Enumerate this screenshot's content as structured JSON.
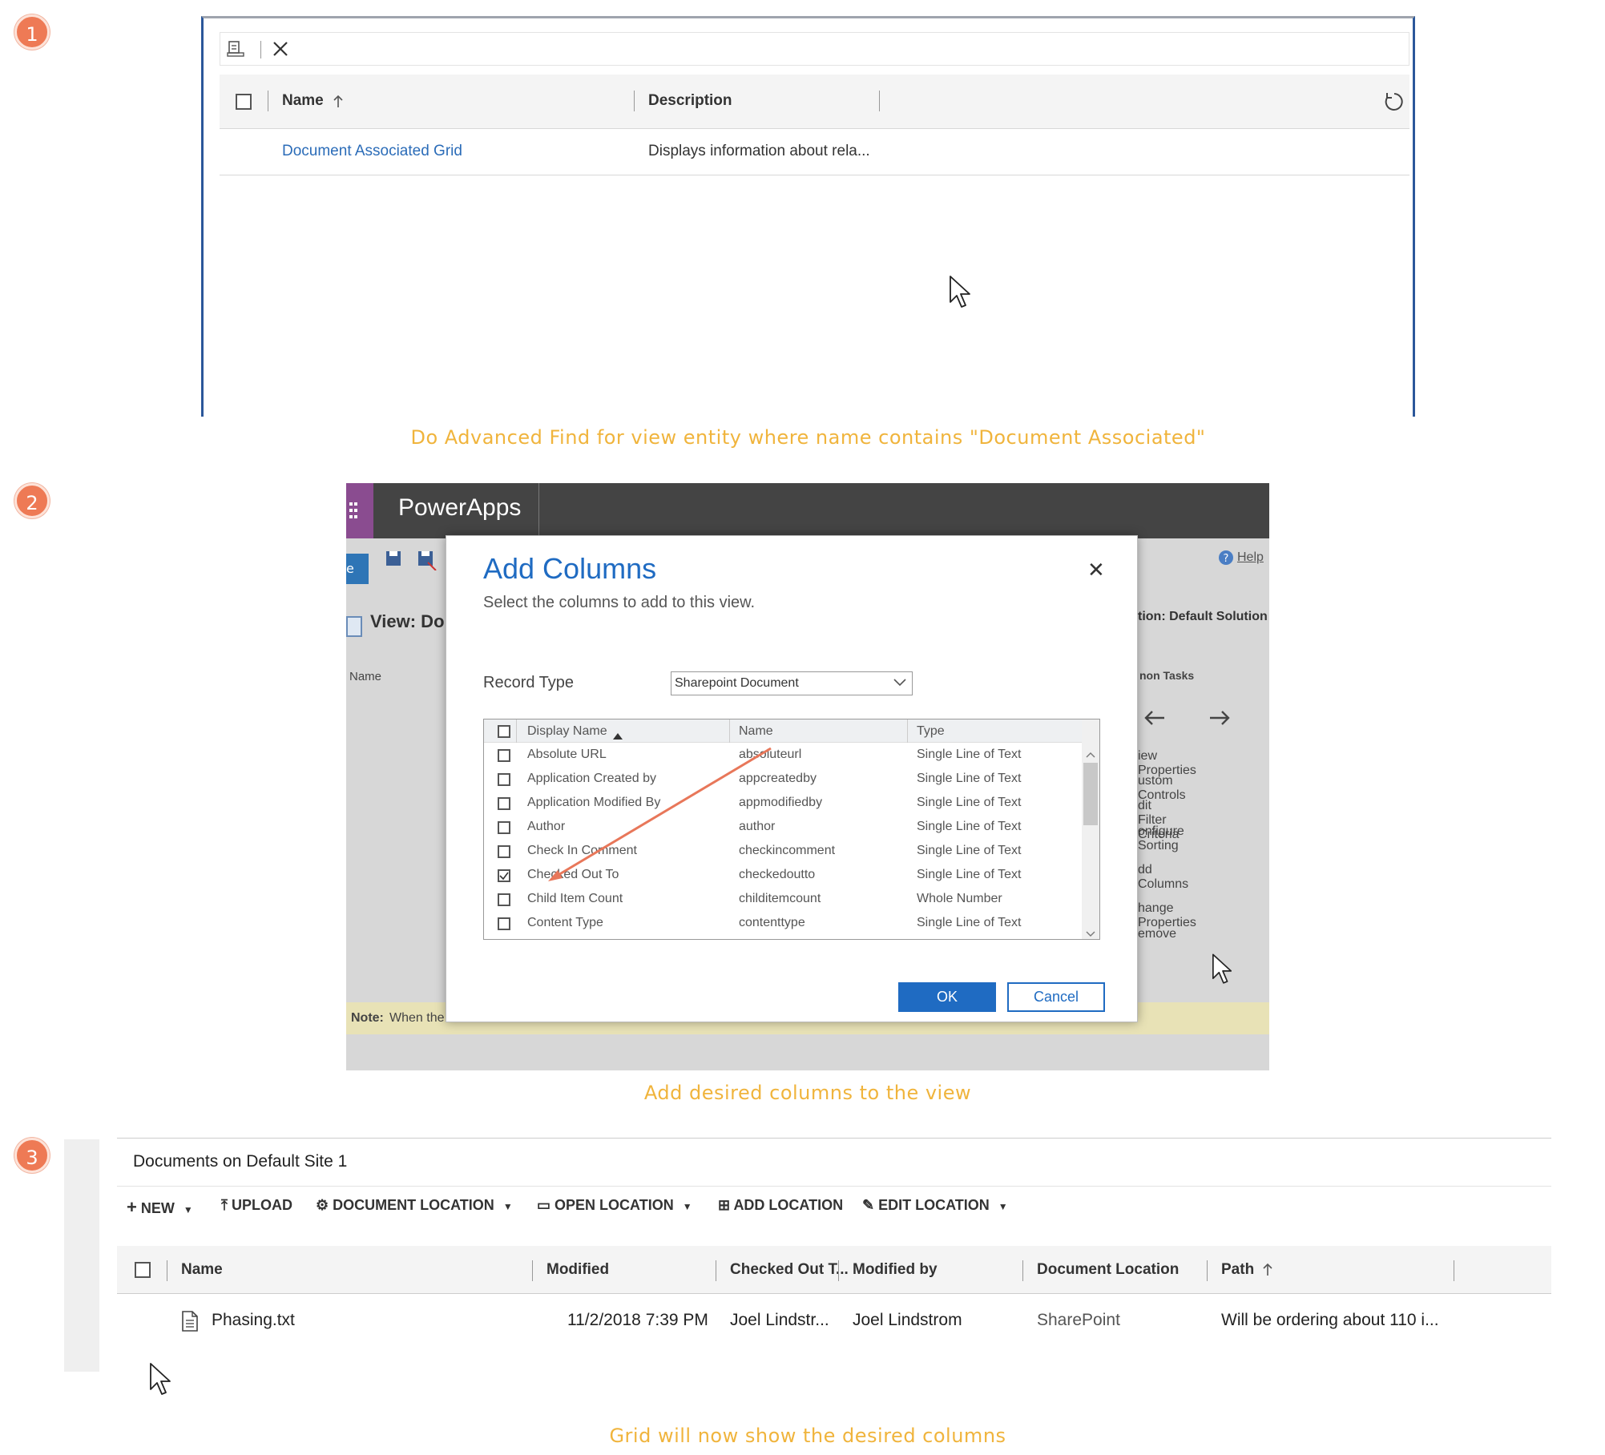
{
  "steps": [
    "1",
    "2",
    "3"
  ],
  "captions": {
    "step1": "Do Advanced Find for view entity where name contains \"Document Associated\"",
    "step2": "Add desired columns to the view",
    "step3": "Grid will now show the desired columns"
  },
  "panel1": {
    "columns": {
      "name": "Name",
      "description": "Description"
    },
    "row": {
      "name": "Document Associated Grid",
      "description": "Displays information about rela..."
    }
  },
  "panel2": {
    "brand": "PowerApps",
    "help": "Help",
    "view_title": "View: Do",
    "bg_name_col": "Name",
    "solution": "tion: Default Solution",
    "common_tasks": "non Tasks",
    "tasks": [
      "iew Properties",
      "ustom Controls",
      "dit Filter Criteria",
      "onfigure Sorting",
      "dd Columns",
      "hange Properties",
      "emove"
    ],
    "note_label": "Note:",
    "note_text": "When the",
    "dialog": {
      "title": "Add Columns",
      "subtitle": "Select the columns to add to this view.",
      "record_type_label": "Record Type",
      "record_type_value": "Sharepoint Document",
      "columns": {
        "display": "Display Name",
        "name": "Name",
        "type": "Type"
      },
      "rows": [
        {
          "display": "Absolute URL",
          "name": "absoluteurl",
          "type": "Single Line of Text",
          "checked": false
        },
        {
          "display": "Application Created by",
          "name": "appcreatedby",
          "type": "Single Line of Text",
          "checked": false
        },
        {
          "display": "Application Modified By",
          "name": "appmodifiedby",
          "type": "Single Line of Text",
          "checked": false
        },
        {
          "display": "Author",
          "name": "author",
          "type": "Single Line of Text",
          "checked": false
        },
        {
          "display": "Check In Comment",
          "name": "checkincomment",
          "type": "Single Line of Text",
          "checked": false
        },
        {
          "display": "Checked Out To",
          "name": "checkedoutto",
          "type": "Single Line of Text",
          "checked": true
        },
        {
          "display": "Child Item Count",
          "name": "childitemcount",
          "type": "Whole Number",
          "checked": false
        },
        {
          "display": "Content Type",
          "name": "contenttype",
          "type": "Single Line of Text",
          "checked": false
        }
      ],
      "ok": "OK",
      "cancel": "Cancel"
    }
  },
  "panel3": {
    "title": "Documents on Default Site 1",
    "commands": {
      "new": "NEW",
      "upload": "UPLOAD",
      "doc_location": "DOCUMENT LOCATION",
      "open_location": "OPEN LOCATION",
      "add_location": "ADD LOCATION",
      "edit_location": "EDIT LOCATION"
    },
    "columns": {
      "name": "Name",
      "modified": "Modified",
      "checked_out": "Checked Out T...",
      "modified_by": "Modified by",
      "doc_location": "Document Location",
      "path": "Path"
    },
    "row": {
      "name": "Phasing.txt",
      "modified": "11/2/2018 7:39 PM",
      "checked_out": "Joel Lindstr...",
      "modified_by": "Joel Lindstrom",
      "doc_location": "SharePoint",
      "path": "Will be ordering about 110 i..."
    }
  },
  "colors": {
    "badge": "#ee7a55",
    "caption": "#f0b43c",
    "link": "#2b6cb8",
    "dialog_title": "#1f6bc2",
    "arrow": "#e8775a"
  }
}
